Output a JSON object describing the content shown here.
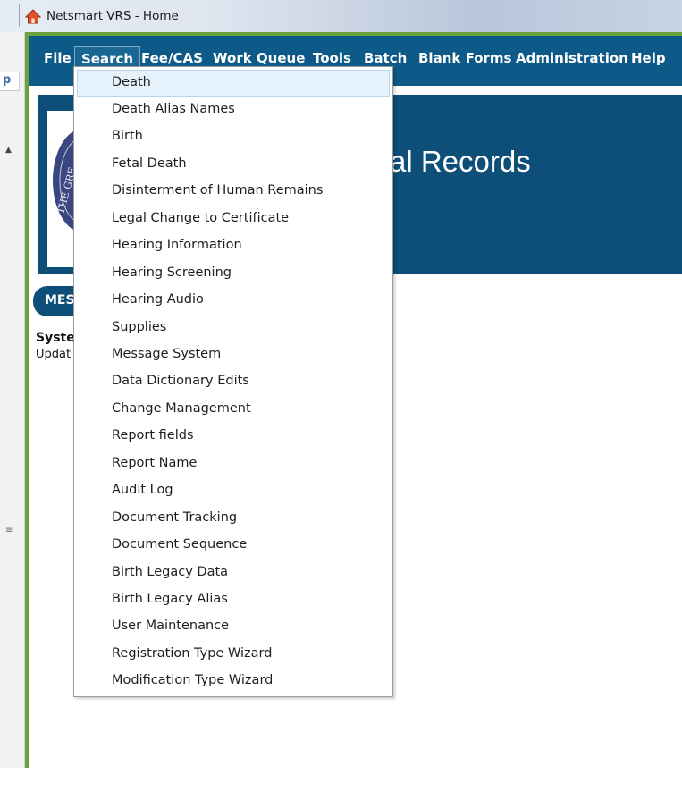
{
  "window": {
    "title": "Netsmart VRS - Home"
  },
  "left_strip": {
    "tab_glyph": "p"
  },
  "menubar": {
    "items": [
      "File",
      "Search",
      "Fee/CAS",
      "Work Queue",
      "Tools",
      "Batch",
      "Blank Forms",
      "Administration",
      "Help"
    ],
    "active": "Search"
  },
  "banner": {
    "title_visible": "al Records",
    "seal_text": "THE GRE"
  },
  "messages": {
    "tab_label": "MES",
    "heading": "Syste",
    "text": "Updat"
  },
  "search_menu": {
    "highlighted": "Death",
    "items": [
      "Death",
      "Death Alias Names",
      "Birth",
      "Fetal Death",
      "Disinterment of Human Remains",
      "Legal Change to Certificate",
      "Hearing Information",
      "Hearing Screening",
      "Hearing Audio",
      "Supplies",
      "Message System",
      "Data Dictionary Edits",
      "Change Management",
      "Report fields",
      "Report Name",
      "Audit Log",
      "Document Tracking",
      "Document Sequence",
      "Birth Legacy Data",
      "Birth Legacy Alias",
      "User Maintenance",
      "Registration Type Wizard",
      "Modification Type Wizard"
    ]
  },
  "colors": {
    "menubar": "#0d5a88",
    "banner": "#0d4f78",
    "frame": "#6aa33c",
    "highlight": "#e5f1fb"
  }
}
